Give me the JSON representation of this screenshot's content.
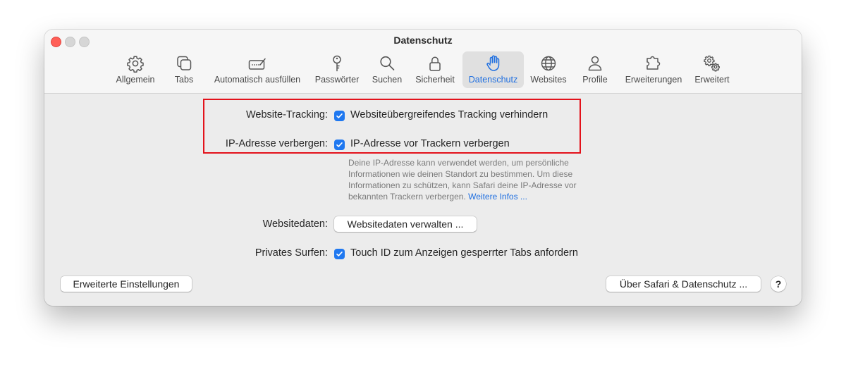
{
  "window": {
    "title": "Datenschutz"
  },
  "toolbar": {
    "tabs": [
      {
        "label": "Allgemein",
        "icon": "gear-icon"
      },
      {
        "label": "Tabs",
        "icon": "tabs-icon"
      },
      {
        "label": "Automatisch ausfüllen",
        "icon": "autofill-icon"
      },
      {
        "label": "Passwörter",
        "icon": "key-icon"
      },
      {
        "label": "Suchen",
        "icon": "search-icon"
      },
      {
        "label": "Sicherheit",
        "icon": "lock-icon"
      },
      {
        "label": "Datenschutz",
        "icon": "hand-icon"
      },
      {
        "label": "Websites",
        "icon": "globe-icon"
      },
      {
        "label": "Profile",
        "icon": "person-icon"
      },
      {
        "label": "Erweiterungen",
        "icon": "puzzle-icon"
      },
      {
        "label": "Erweitert",
        "icon": "gears-icon"
      }
    ],
    "active_tab": "Datenschutz",
    "accent_color": "#1f6fe0"
  },
  "settings": {
    "tracking": {
      "label": "Website-Tracking:",
      "checkbox_label": "Websiteübergreifendes Tracking verhindern",
      "checked": true
    },
    "ip": {
      "label": "IP-Adresse verbergen:",
      "checkbox_label": "IP-Adresse vor Trackern verbergen",
      "checked": true,
      "note_lines": [
        "Deine IP-Adresse kann verwendet werden, um persönliche",
        "Informationen wie deinen Standort zu bestimmen. Um diese",
        "Informationen zu schützen, kann Safari deine IP-Adresse vor",
        "bekannten Trackern verbergen."
      ],
      "note_link": "Weitere Infos ..."
    },
    "website_data": {
      "label": "Websitedaten:",
      "button_label": "Websitedaten verwalten ..."
    },
    "private": {
      "label": "Privates Surfen:",
      "checkbox_label": "Touch ID zum Anzeigen gesperrter Tabs anfordern",
      "checked": true
    }
  },
  "footer": {
    "advanced_button": "Erweiterte Einstellungen",
    "about_button": "Über Safari & Datenschutz ...",
    "help_button": "?"
  },
  "annotation": {
    "highlight_color": "#e3121b"
  }
}
